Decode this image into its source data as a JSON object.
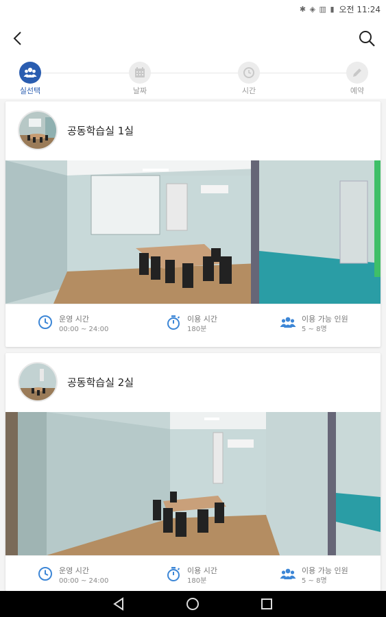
{
  "status_bar": {
    "icons": "✱ ◈ ▥ ▮",
    "time_label": "오전 11:24"
  },
  "steps": [
    {
      "label": "실선택",
      "active": true
    },
    {
      "label": "날짜",
      "active": false
    },
    {
      "label": "시간",
      "active": false
    },
    {
      "label": "예약",
      "active": false
    }
  ],
  "rooms": [
    {
      "name": "공동학습실 1실",
      "operating_label": "운영 시간",
      "operating_value": "00:00 ~ 24:00",
      "usage_label": "이용 시간",
      "usage_value": "180분",
      "capacity_label": "이용 가능 인원",
      "capacity_value": "5 ~ 8명"
    },
    {
      "name": "공동학습실 2실",
      "operating_label": "운영 시간",
      "operating_value": "00:00 ~ 24:00",
      "usage_label": "이용 시간",
      "usage_value": "180분",
      "capacity_label": "이용 가능 인원",
      "capacity_value": "5 ~ 8명"
    }
  ],
  "colors": {
    "accent": "#2a5db0",
    "icon_blue": "#3c86d6",
    "inactive": "#9a9a9a"
  }
}
